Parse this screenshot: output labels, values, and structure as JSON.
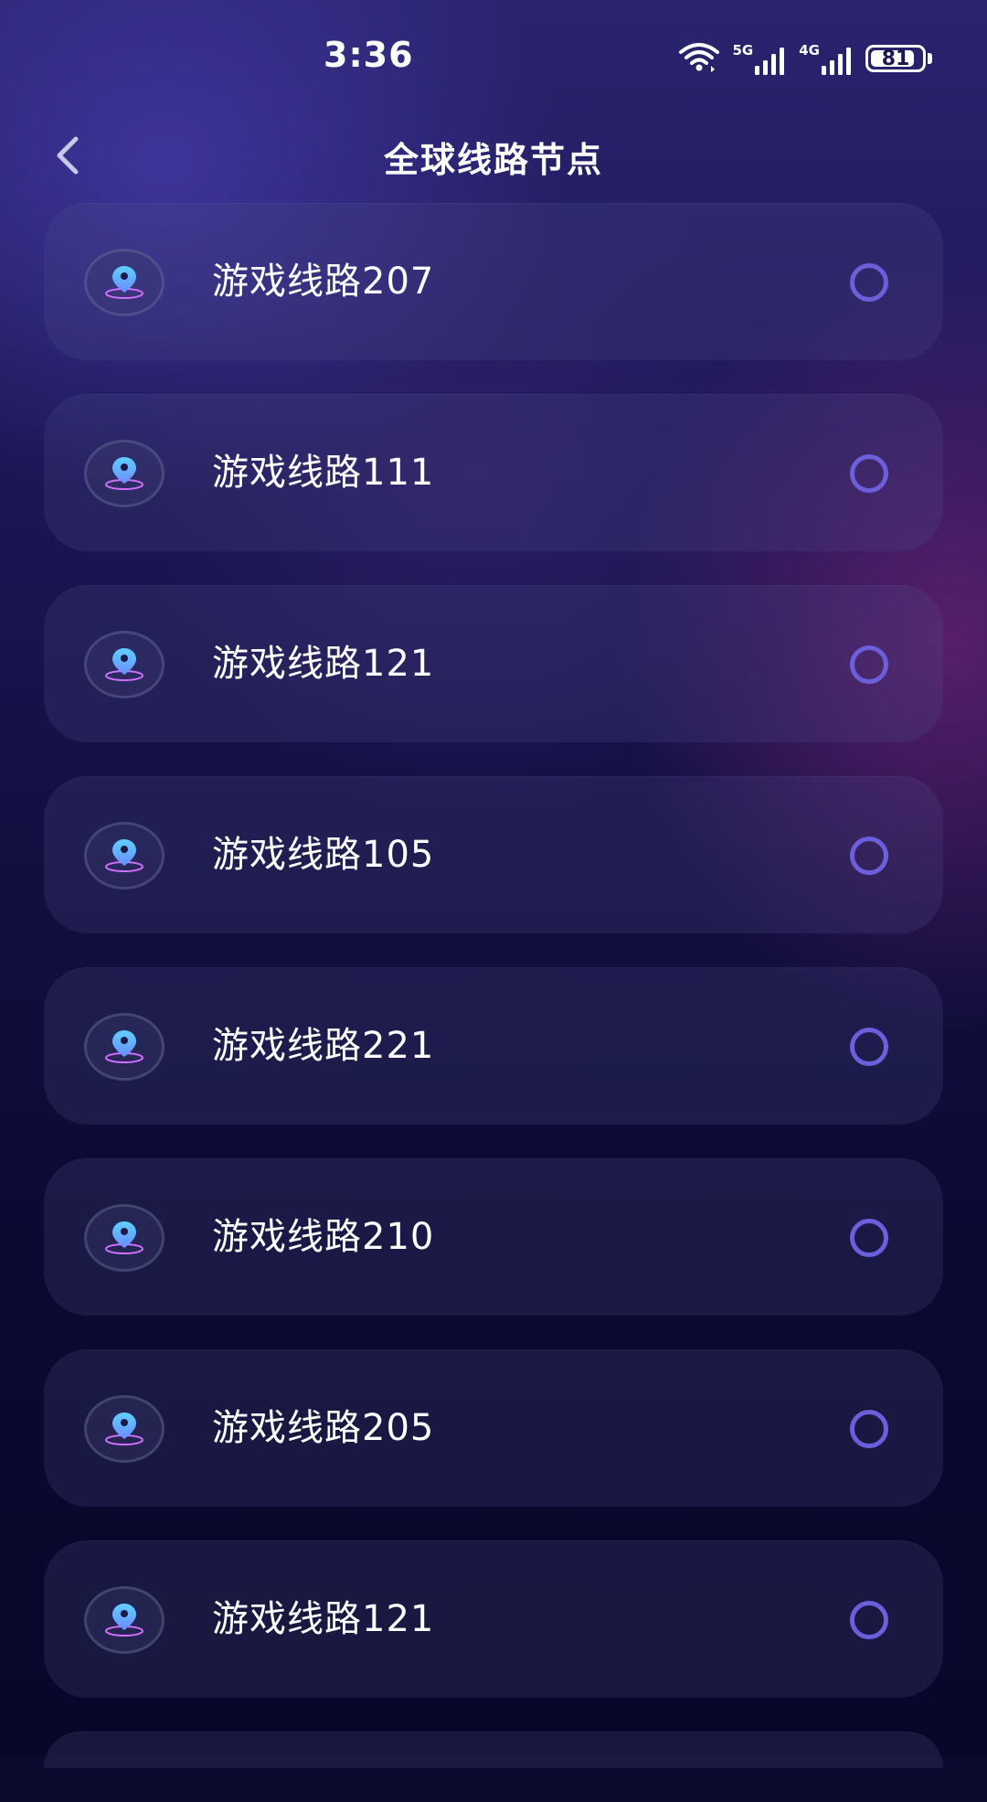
{
  "status_bar": {
    "time": "3:36",
    "network_1": "5G",
    "network_2": "4G",
    "battery_level": "81",
    "icons": [
      "wifi-icon",
      "signal-5g-icon",
      "signal-4g-icon",
      "battery-icon"
    ]
  },
  "header": {
    "back_icon": "chevron-left-icon",
    "title": "全球线路节点"
  },
  "routes": [
    {
      "label": "游戏线路207",
      "selected": false
    },
    {
      "label": "游戏线路111",
      "selected": false
    },
    {
      "label": "游戏线路121",
      "selected": false
    },
    {
      "label": "游戏线路105",
      "selected": false
    },
    {
      "label": "游戏线路221",
      "selected": false
    },
    {
      "label": "游戏线路210",
      "selected": false
    },
    {
      "label": "游戏线路205",
      "selected": false
    },
    {
      "label": "游戏线路121",
      "selected": false
    }
  ],
  "colors": {
    "radio": "#6b5fdc",
    "pin_top": "#5fd0ff",
    "pin_bottom": "#6a8cff",
    "ring": "#d070ff"
  }
}
